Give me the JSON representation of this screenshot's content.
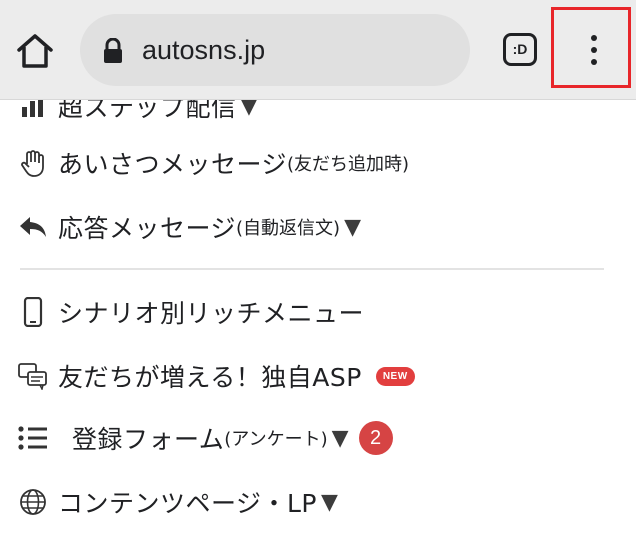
{
  "browser": {
    "url": "autosns.jp",
    "tab_label": ":D",
    "icons": [
      "home-icon",
      "lock-icon",
      "tab-switcher-icon",
      "more-vert-icon"
    ],
    "highlight_color": "#e8262a"
  },
  "menu": {
    "items": [
      {
        "label": "超ステップ配信",
        "suffix": "▼",
        "icon": "chart-bars-icon"
      },
      {
        "label": "あいさつメッセージ",
        "note": "(友だち追加時)",
        "icon": "hand-icon"
      },
      {
        "label": "応答メッセージ",
        "note": "(自動返信文)",
        "suffix": "▼",
        "icon": "reply-arrow-icon"
      },
      {
        "label": "シナリオ別リッチメニュー",
        "icon": "smartphone-icon"
      },
      {
        "label": "友だちが増える！独自ASP",
        "badge": "NEW",
        "icon": "chat-bubbles-icon"
      },
      {
        "label": "登録フォーム",
        "note": "(アンケート)",
        "suffix": "▼",
        "count": "2",
        "icon": "list-icon"
      },
      {
        "label": "コンテンツページ・LP",
        "suffix": "▼",
        "icon": "globe-icon"
      }
    ]
  },
  "colors": {
    "badge_red": "#e23e3e",
    "count_red": "#d64444",
    "toolbar_bg": "#ececec"
  }
}
